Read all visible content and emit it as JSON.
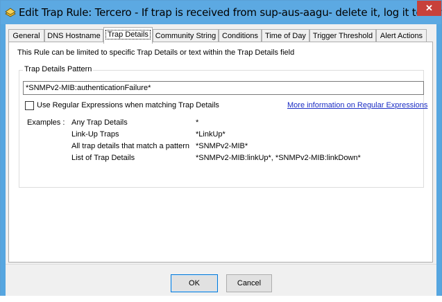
{
  "window": {
    "title": "Edit Trap Rule: Tercero - If trap is received from sup-aus-aagu- delete it, log it to text,...",
    "close_glyph": "✕"
  },
  "tabs": [
    {
      "label": "General"
    },
    {
      "label": "DNS Hostname"
    },
    {
      "label": "Trap Details"
    },
    {
      "label": "Community String"
    },
    {
      "label": "Conditions"
    },
    {
      "label": "Time of Day"
    },
    {
      "label": "Trigger Threshold"
    },
    {
      "label": "Alert Actions"
    }
  ],
  "active_tab": "Trap Details",
  "panel": {
    "description": "This Rule can be limited to specific Trap Details or text within the Trap Details field",
    "group_label": "Trap Details Pattern",
    "pattern_value": "*SNMPv2-MIB:authenticationFailure*",
    "regex_checkbox_label": "Use Regular Expressions when matching Trap Details",
    "regex_checked": false,
    "regex_link": "More information on Regular Expressions",
    "examples_label": "Examples :",
    "examples": [
      {
        "name": "Any Trap Details",
        "value": "*"
      },
      {
        "name": "Link-Up Traps",
        "value": "*LinkUp*"
      },
      {
        "name": "All trap details that match a pattern",
        "value": "*SNMPv2-MIB*"
      },
      {
        "name": "List of Trap Details",
        "value": "*SNMPv2-MIB:linkUp*, *SNMPv2-MIB:linkDown*"
      }
    ]
  },
  "buttons": {
    "ok": "OK",
    "cancel": "Cancel"
  },
  "icons": {
    "app": "trap-rule-icon",
    "close": "close-icon"
  },
  "colors": {
    "titlebar": "#5ca9e2",
    "close": "#c7413a",
    "link": "#1a2cc4"
  }
}
